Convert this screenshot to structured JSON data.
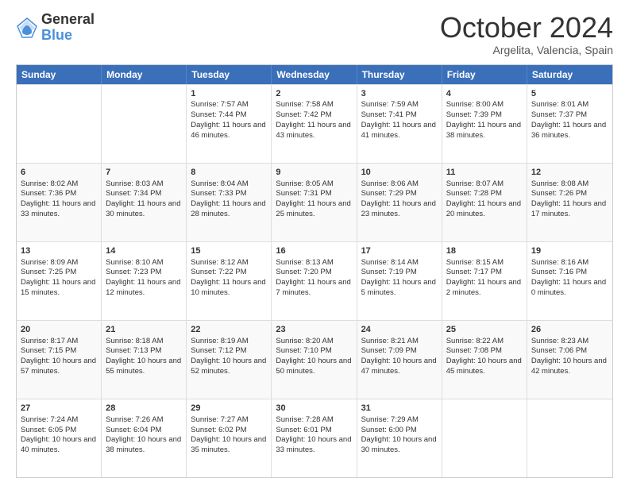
{
  "header": {
    "logo_line1": "General",
    "logo_line2": "Blue",
    "month": "October 2024",
    "location": "Argelita, Valencia, Spain"
  },
  "weekdays": [
    "Sunday",
    "Monday",
    "Tuesday",
    "Wednesday",
    "Thursday",
    "Friday",
    "Saturday"
  ],
  "rows": [
    [
      {
        "day": "",
        "info": ""
      },
      {
        "day": "",
        "info": ""
      },
      {
        "day": "1",
        "info": "Sunrise: 7:57 AM\nSunset: 7:44 PM\nDaylight: 11 hours and 46 minutes."
      },
      {
        "day": "2",
        "info": "Sunrise: 7:58 AM\nSunset: 7:42 PM\nDaylight: 11 hours and 43 minutes."
      },
      {
        "day": "3",
        "info": "Sunrise: 7:59 AM\nSunset: 7:41 PM\nDaylight: 11 hours and 41 minutes."
      },
      {
        "day": "4",
        "info": "Sunrise: 8:00 AM\nSunset: 7:39 PM\nDaylight: 11 hours and 38 minutes."
      },
      {
        "day": "5",
        "info": "Sunrise: 8:01 AM\nSunset: 7:37 PM\nDaylight: 11 hours and 36 minutes."
      }
    ],
    [
      {
        "day": "6",
        "info": "Sunrise: 8:02 AM\nSunset: 7:36 PM\nDaylight: 11 hours and 33 minutes."
      },
      {
        "day": "7",
        "info": "Sunrise: 8:03 AM\nSunset: 7:34 PM\nDaylight: 11 hours and 30 minutes."
      },
      {
        "day": "8",
        "info": "Sunrise: 8:04 AM\nSunset: 7:33 PM\nDaylight: 11 hours and 28 minutes."
      },
      {
        "day": "9",
        "info": "Sunrise: 8:05 AM\nSunset: 7:31 PM\nDaylight: 11 hours and 25 minutes."
      },
      {
        "day": "10",
        "info": "Sunrise: 8:06 AM\nSunset: 7:29 PM\nDaylight: 11 hours and 23 minutes."
      },
      {
        "day": "11",
        "info": "Sunrise: 8:07 AM\nSunset: 7:28 PM\nDaylight: 11 hours and 20 minutes."
      },
      {
        "day": "12",
        "info": "Sunrise: 8:08 AM\nSunset: 7:26 PM\nDaylight: 11 hours and 17 minutes."
      }
    ],
    [
      {
        "day": "13",
        "info": "Sunrise: 8:09 AM\nSunset: 7:25 PM\nDaylight: 11 hours and 15 minutes."
      },
      {
        "day": "14",
        "info": "Sunrise: 8:10 AM\nSunset: 7:23 PM\nDaylight: 11 hours and 12 minutes."
      },
      {
        "day": "15",
        "info": "Sunrise: 8:12 AM\nSunset: 7:22 PM\nDaylight: 11 hours and 10 minutes."
      },
      {
        "day": "16",
        "info": "Sunrise: 8:13 AM\nSunset: 7:20 PM\nDaylight: 11 hours and 7 minutes."
      },
      {
        "day": "17",
        "info": "Sunrise: 8:14 AM\nSunset: 7:19 PM\nDaylight: 11 hours and 5 minutes."
      },
      {
        "day": "18",
        "info": "Sunrise: 8:15 AM\nSunset: 7:17 PM\nDaylight: 11 hours and 2 minutes."
      },
      {
        "day": "19",
        "info": "Sunrise: 8:16 AM\nSunset: 7:16 PM\nDaylight: 11 hours and 0 minutes."
      }
    ],
    [
      {
        "day": "20",
        "info": "Sunrise: 8:17 AM\nSunset: 7:15 PM\nDaylight: 10 hours and 57 minutes."
      },
      {
        "day": "21",
        "info": "Sunrise: 8:18 AM\nSunset: 7:13 PM\nDaylight: 10 hours and 55 minutes."
      },
      {
        "day": "22",
        "info": "Sunrise: 8:19 AM\nSunset: 7:12 PM\nDaylight: 10 hours and 52 minutes."
      },
      {
        "day": "23",
        "info": "Sunrise: 8:20 AM\nSunset: 7:10 PM\nDaylight: 10 hours and 50 minutes."
      },
      {
        "day": "24",
        "info": "Sunrise: 8:21 AM\nSunset: 7:09 PM\nDaylight: 10 hours and 47 minutes."
      },
      {
        "day": "25",
        "info": "Sunrise: 8:22 AM\nSunset: 7:08 PM\nDaylight: 10 hours and 45 minutes."
      },
      {
        "day": "26",
        "info": "Sunrise: 8:23 AM\nSunset: 7:06 PM\nDaylight: 10 hours and 42 minutes."
      }
    ],
    [
      {
        "day": "27",
        "info": "Sunrise: 7:24 AM\nSunset: 6:05 PM\nDaylight: 10 hours and 40 minutes."
      },
      {
        "day": "28",
        "info": "Sunrise: 7:26 AM\nSunset: 6:04 PM\nDaylight: 10 hours and 38 minutes."
      },
      {
        "day": "29",
        "info": "Sunrise: 7:27 AM\nSunset: 6:02 PM\nDaylight: 10 hours and 35 minutes."
      },
      {
        "day": "30",
        "info": "Sunrise: 7:28 AM\nSunset: 6:01 PM\nDaylight: 10 hours and 33 minutes."
      },
      {
        "day": "31",
        "info": "Sunrise: 7:29 AM\nSunset: 6:00 PM\nDaylight: 10 hours and 30 minutes."
      },
      {
        "day": "",
        "info": ""
      },
      {
        "day": "",
        "info": ""
      }
    ]
  ]
}
